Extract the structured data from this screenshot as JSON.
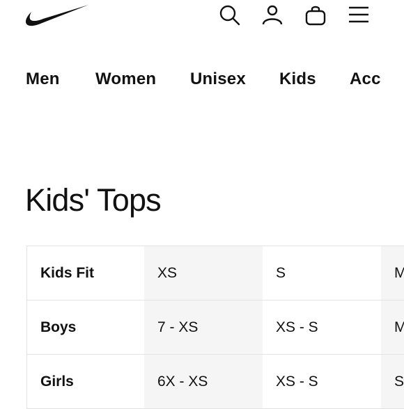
{
  "header": {
    "icons": [
      "nike-swoosh-logo",
      "search-icon",
      "account-icon",
      "bag-icon",
      "menu-icon"
    ]
  },
  "nav": {
    "items": [
      "Men",
      "Women",
      "Unisex",
      "Kids",
      "Acc"
    ]
  },
  "page": {
    "title": "Kids' Tops"
  },
  "size_table": {
    "rows": [
      {
        "label": "Kids Fit",
        "cells": [
          "XS",
          "S",
          "M"
        ]
      },
      {
        "label": "Boys",
        "cells": [
          "7 - XS",
          "XS - S",
          "M"
        ]
      },
      {
        "label": "Girls",
        "cells": [
          "6X - XS",
          "XS - S",
          "S"
        ]
      }
    ]
  },
  "colors": {
    "text": "#111111",
    "shaded_column": "#f5f5f5",
    "border": "#e3e3e3"
  }
}
